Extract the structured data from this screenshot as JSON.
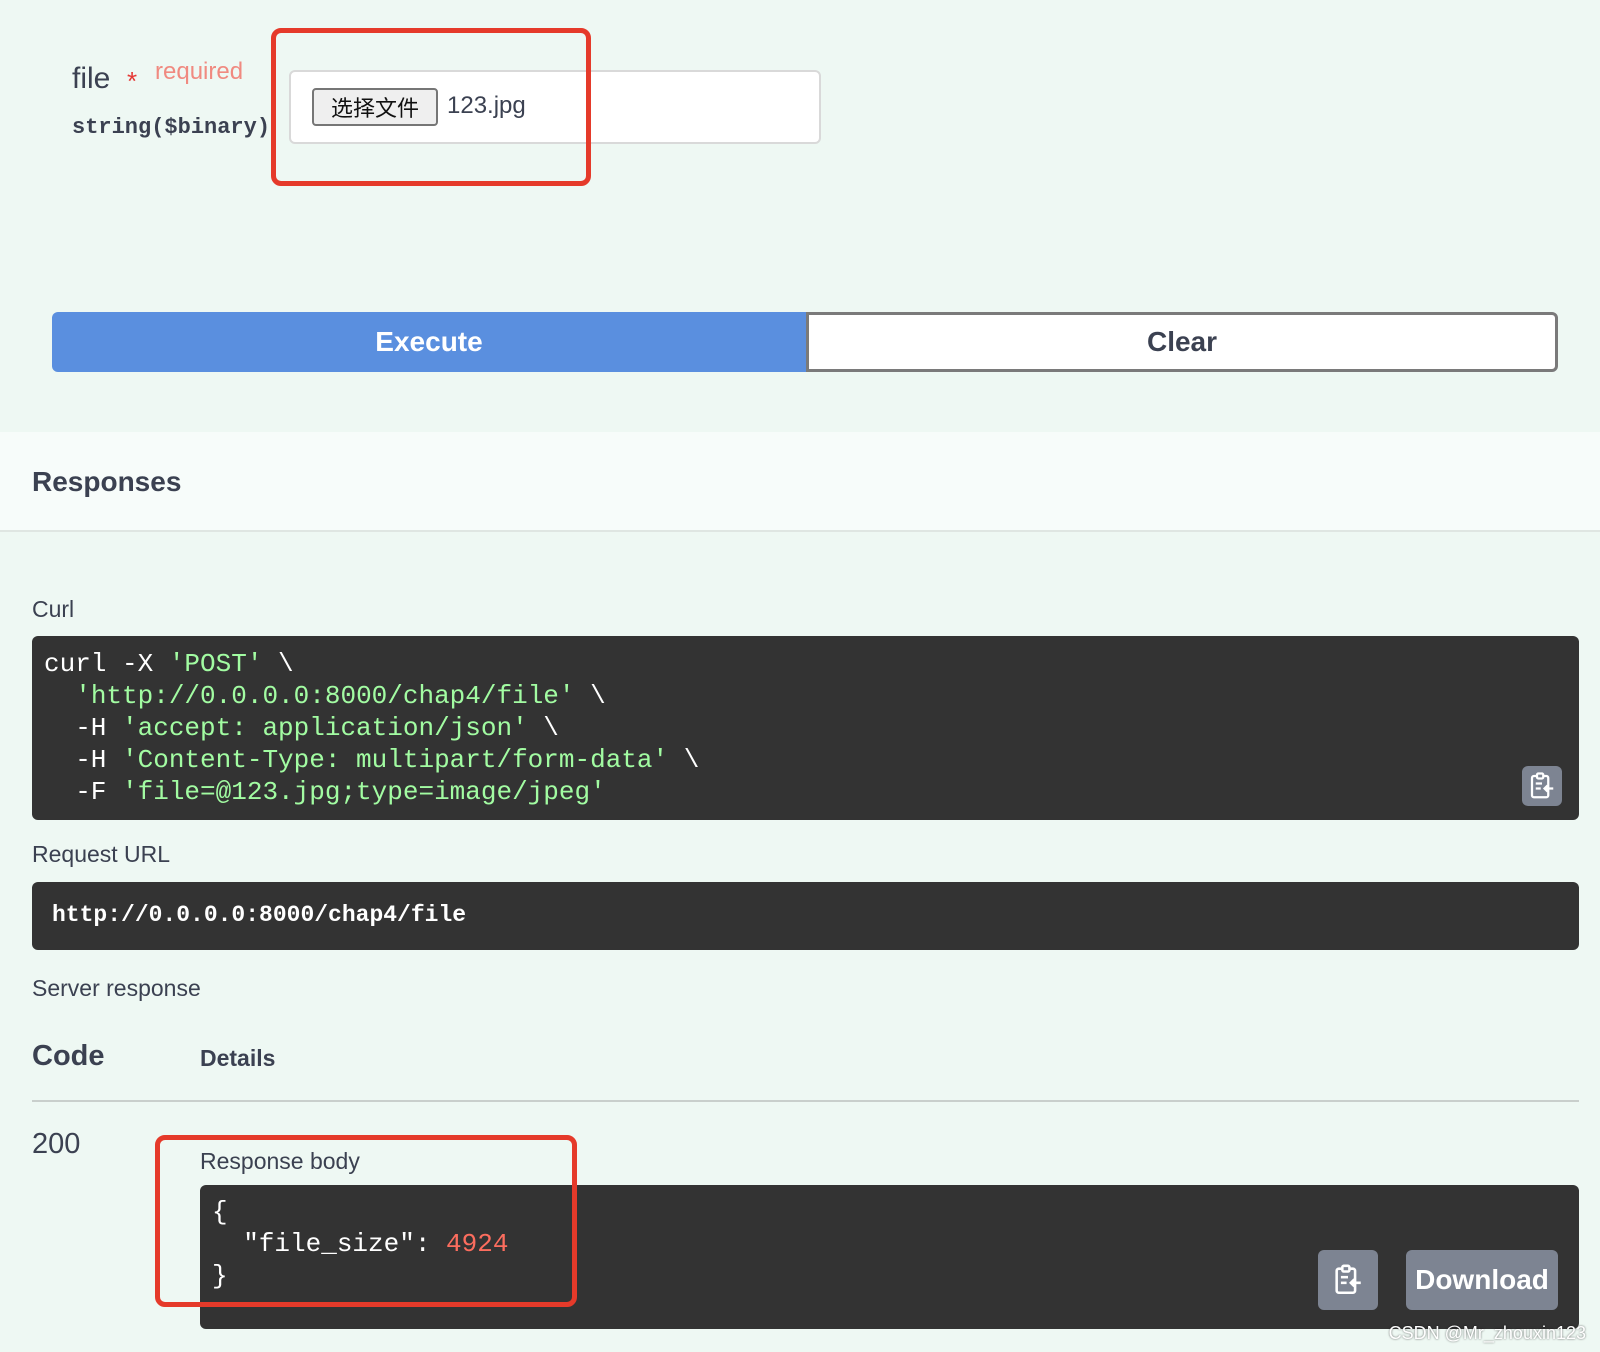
{
  "parameter": {
    "name": "file",
    "required_star": "*",
    "required_label": "required",
    "type": "string($binary)",
    "choose_file_label": "选择文件",
    "file_name": "123.jpg"
  },
  "actions": {
    "execute_label": "Execute",
    "clear_label": "Clear",
    "execute_color": "#5a8fdf"
  },
  "responses": {
    "title": "Responses",
    "curl_label": "Curl",
    "curl": {
      "l1_a": "curl -X ",
      "l1_b": "'POST'",
      "l1_c": " \\",
      "l2_a": "  ",
      "l2_b": "'http://0.0.0.0:8000/chap4/file'",
      "l2_c": " \\",
      "l3_a": "  -H ",
      "l3_b": "'accept: application/json'",
      "l3_c": " \\",
      "l4_a": "  -H ",
      "l4_b": "'Content-Type: multipart/form-data'",
      "l4_c": " \\",
      "l5_a": "  -F ",
      "l5_b": "'file=@123.jpg;type=image/jpeg'"
    },
    "request_url_label": "Request URL",
    "request_url": "http://0.0.0.0:8000/chap4/file",
    "server_response_label": "Server response",
    "col_code": "Code",
    "col_details": "Details",
    "status_code": "200",
    "response_body_label": "Response body",
    "body": {
      "open": "{",
      "key": "  \"file_size\": ",
      "value": "4924",
      "close": "}"
    },
    "download_label": "Download"
  },
  "icons": {
    "copy": "clipboard-copy-icon"
  },
  "colors": {
    "highlight": "#e53a2a",
    "string": "#a2fca2",
    "number": "#fc6d5e"
  },
  "watermark": "CSDN @Mr_zhouxin123"
}
